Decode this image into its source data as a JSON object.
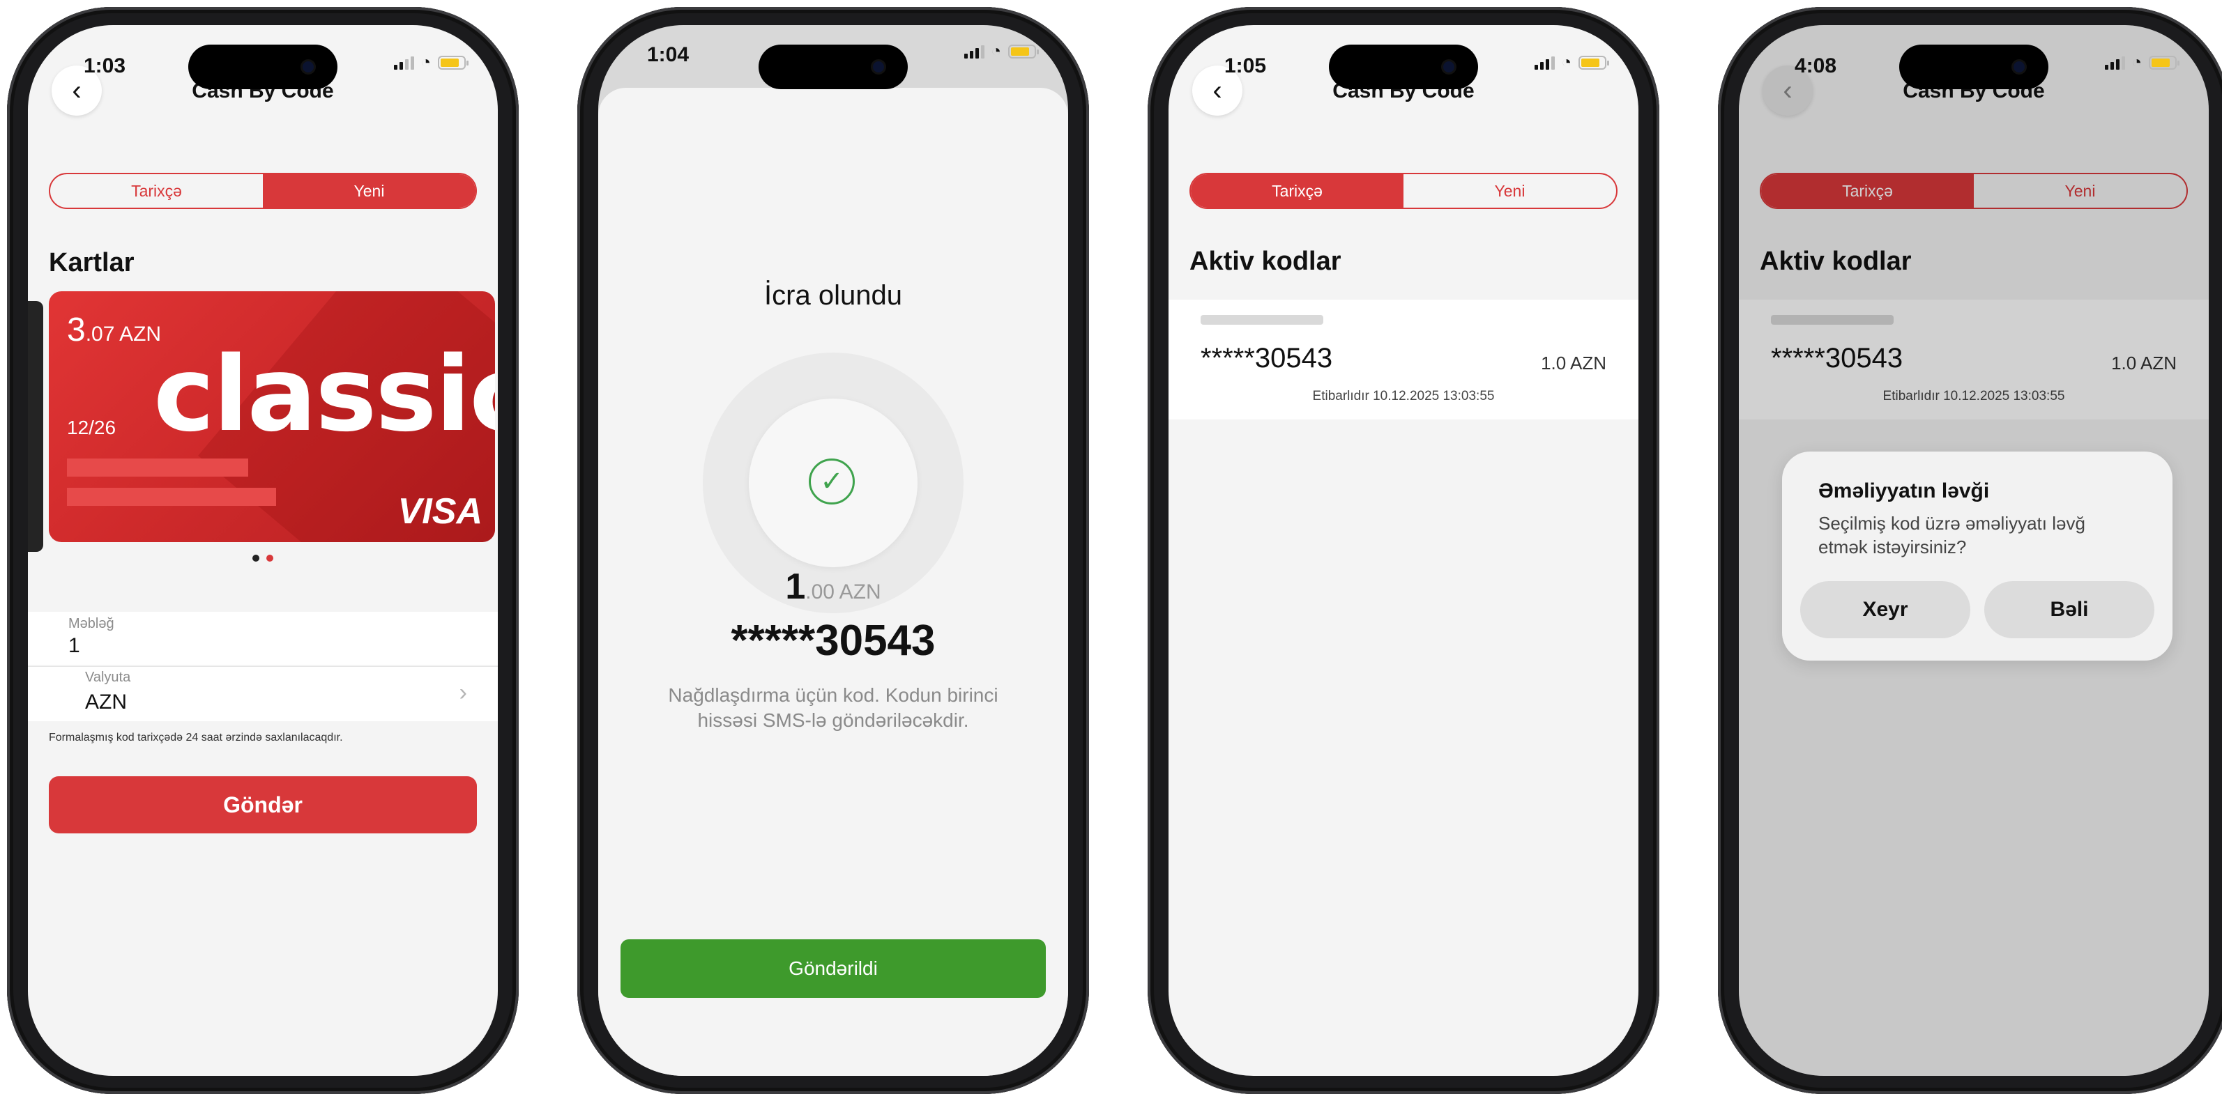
{
  "screens": [
    {
      "time": "1:03",
      "title": "Cash By Code",
      "tabs": [
        {
          "label": "Tarixçə",
          "active": false
        },
        {
          "label": "Yeni",
          "active": true
        }
      ],
      "section": "Kartlar",
      "card": {
        "balance_int": "3",
        "balance_rest": ".07 AZN",
        "brand": "classic",
        "expiry": "12/26",
        "network": "VISA"
      },
      "amount_label": "Məbləğ",
      "amount_value": "1",
      "currency_label": "Valyuta",
      "currency_value": "AZN",
      "hint": "Formalaşmış kod tarixçədə 24 saat ərzində saxlanılacaqdır.",
      "submit": "Göndər"
    },
    {
      "time": "1:04",
      "status_title": "İcra olundu",
      "amount_int": "1",
      "amount_rest": ".00 AZN",
      "code": "*****30543",
      "message": "Nağdlaşdırma üçün kod. Kodun birinci hissəsi SMS-lə göndəriləcəkdir.",
      "button": "Göndərildi"
    },
    {
      "time": "1:05",
      "title": "Cash By Code",
      "tabs": [
        {
          "label": "Tarixçə",
          "active": true
        },
        {
          "label": "Yeni",
          "active": false
        }
      ],
      "section": "Aktiv kodlar",
      "code": "*****30543",
      "amount": "1.0 AZN",
      "validity": "Etibarlıdır 10.12.2025 13:03:55"
    },
    {
      "time": "4:08",
      "title": "Cash By Code",
      "tabs": [
        {
          "label": "Tarixçə",
          "active": true
        },
        {
          "label": "Yeni",
          "active": false
        }
      ],
      "section": "Aktiv kodlar",
      "code": "*****30543",
      "amount": "1.0 AZN",
      "validity": "Etibarlıdır 10.12.2025 13:03:55",
      "dialog": {
        "title": "Əməliyyatın ləvği",
        "message": "Seçilmiş kod üzrə əməliyyatı ləvğ etmək istəyirsiniz?",
        "cancel": "Xeyr",
        "confirm": "Bəli"
      }
    }
  ],
  "colors": {
    "accent": "#d8383a",
    "success": "#3e9a2c",
    "background": "#f4f4f4"
  },
  "icons": [
    "back-arrow-icon",
    "signal-icon",
    "wifi-icon",
    "battery-icon",
    "chevron-right-icon",
    "checkmark-icon"
  ]
}
